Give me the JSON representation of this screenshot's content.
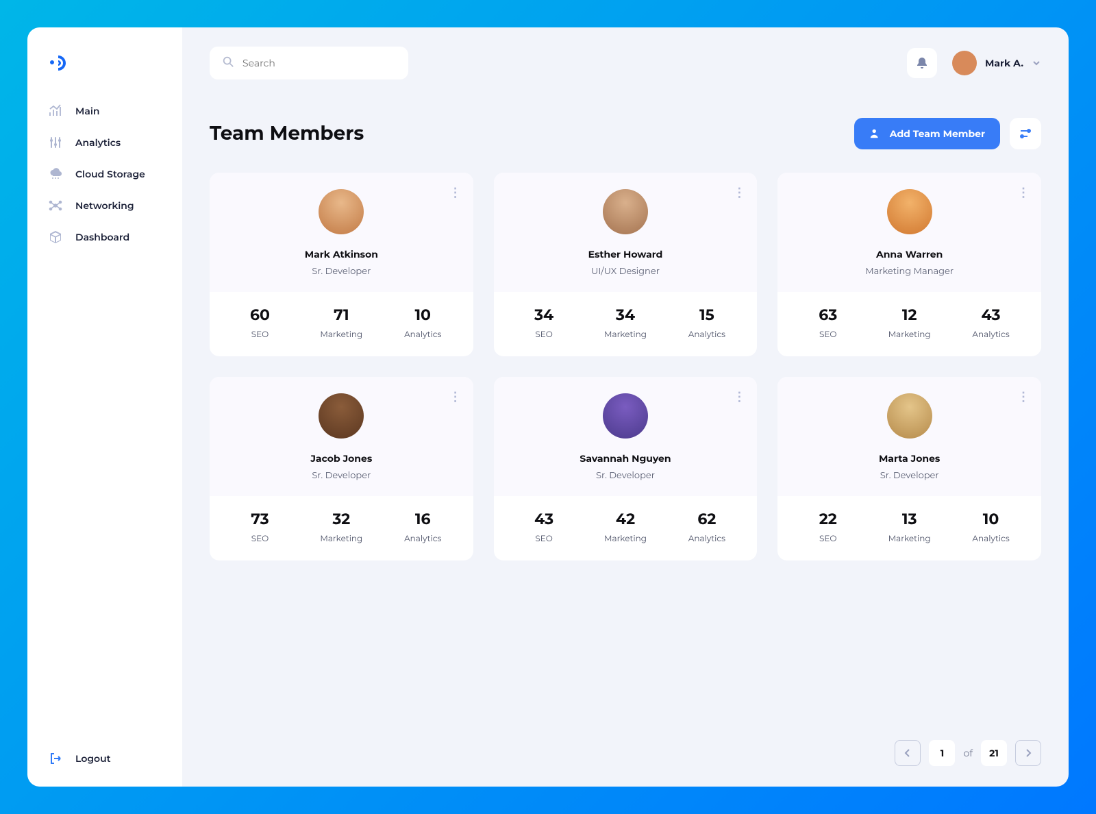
{
  "search": {
    "placeholder": "Search"
  },
  "user": {
    "name": "Mark A."
  },
  "sidebar": {
    "items": [
      {
        "label": "Main"
      },
      {
        "label": "Analytics"
      },
      {
        "label": "Cloud Storage"
      },
      {
        "label": "Networking"
      },
      {
        "label": "Dashboard"
      }
    ],
    "logout": "Logout"
  },
  "page": {
    "title": "Team Members",
    "add_button": "Add Team Member"
  },
  "stat_labels": {
    "seo": "SEO",
    "marketing": "Marketing",
    "analytics": "Analytics"
  },
  "members": [
    {
      "name": "Mark Atkinson",
      "role": "Sr. Developer",
      "seo": "60",
      "marketing": "71",
      "analytics": "10"
    },
    {
      "name": "Esther Howard",
      "role": "UI/UX Designer",
      "seo": "34",
      "marketing": "34",
      "analytics": "15"
    },
    {
      "name": "Anna Warren",
      "role": "Marketing Manager",
      "seo": "63",
      "marketing": "12",
      "analytics": "43"
    },
    {
      "name": "Jacob Jones",
      "role": "Sr. Developer",
      "seo": "73",
      "marketing": "32",
      "analytics": "16"
    },
    {
      "name": "Savannah Nguyen",
      "role": "Sr. Developer",
      "seo": "43",
      "marketing": "42",
      "analytics": "62"
    },
    {
      "name": "Marta Jones",
      "role": "Sr. Developer",
      "seo": "22",
      "marketing": "13",
      "analytics": "10"
    }
  ],
  "pager": {
    "current": "1",
    "of": "of",
    "total": "21"
  }
}
